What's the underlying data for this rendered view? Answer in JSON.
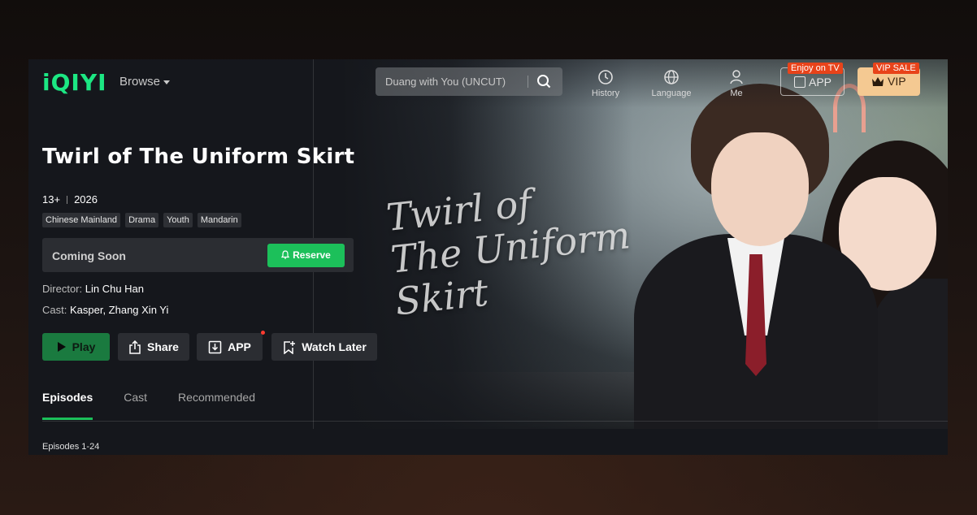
{
  "nav": {
    "logo": "iQIYI",
    "browse_label": "Browse",
    "search_placeholder": "Duang with You (UNCUT)",
    "history_label": "History",
    "language_label": "Language",
    "me_label": "Me",
    "app_label": "APP",
    "app_badge": "Enjoy on TV",
    "vip_label": "VIP",
    "vip_badge": "VIP SALE"
  },
  "show": {
    "title": "Twirl of The Uniform Skirt",
    "rating": "13+",
    "year": "2026",
    "tags": [
      "Chinese Mainland",
      "Drama",
      "Youth",
      "Mandarin"
    ],
    "coming_soon": "Coming Soon",
    "reserve_label": "Reserve",
    "director_label": "Director:",
    "director": "Lin Chu Han",
    "cast_label": "Cast:",
    "cast": "Kasper, Zhang Xin Yi",
    "hero_title_line1": "Twirl of",
    "hero_title_line2": "The Uniform Skirt"
  },
  "actions": {
    "play": "Play",
    "share": "Share",
    "app": "APP",
    "watch_later": "Watch Later"
  },
  "tabs": [
    {
      "label": "Episodes",
      "active": true
    },
    {
      "label": "Cast",
      "active": false
    },
    {
      "label": "Recommended",
      "active": false
    }
  ],
  "episodes_range": "Episodes 1-24",
  "colors": {
    "brand_green": "#1ce783",
    "button_green": "#1cc05a",
    "vip_gold": "#f4c992",
    "badge_red": "#e8431a"
  }
}
